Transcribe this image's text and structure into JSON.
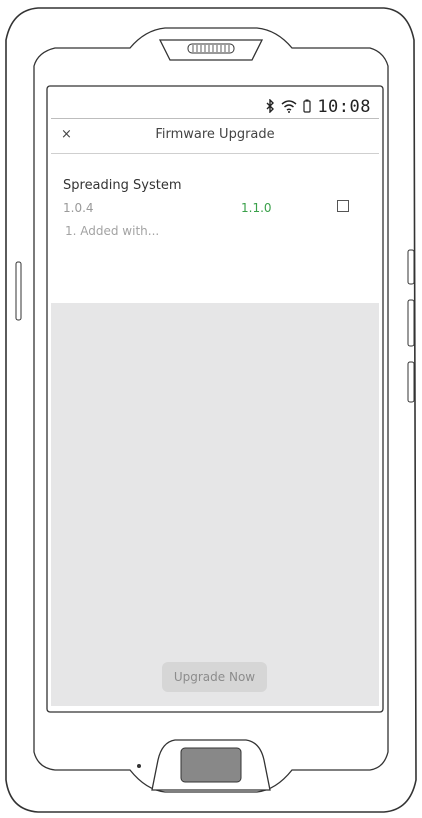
{
  "status_bar": {
    "time": "10:08",
    "icons": [
      "bluetooth-icon",
      "wifi-icon",
      "battery-icon"
    ]
  },
  "header": {
    "close_label": "×",
    "title": "Firmware Upgrade"
  },
  "firmware": {
    "name": "Spreading System",
    "current_version": "1.0.4",
    "new_version": "1.1.0",
    "selected": false,
    "notes": "1. Added with..."
  },
  "footer": {
    "upgrade_label": "Upgrade Now"
  },
  "colors": {
    "new_version": "#3aa04a",
    "screen_background": "#e6e6e7",
    "button_background": "#d6d6d6"
  }
}
